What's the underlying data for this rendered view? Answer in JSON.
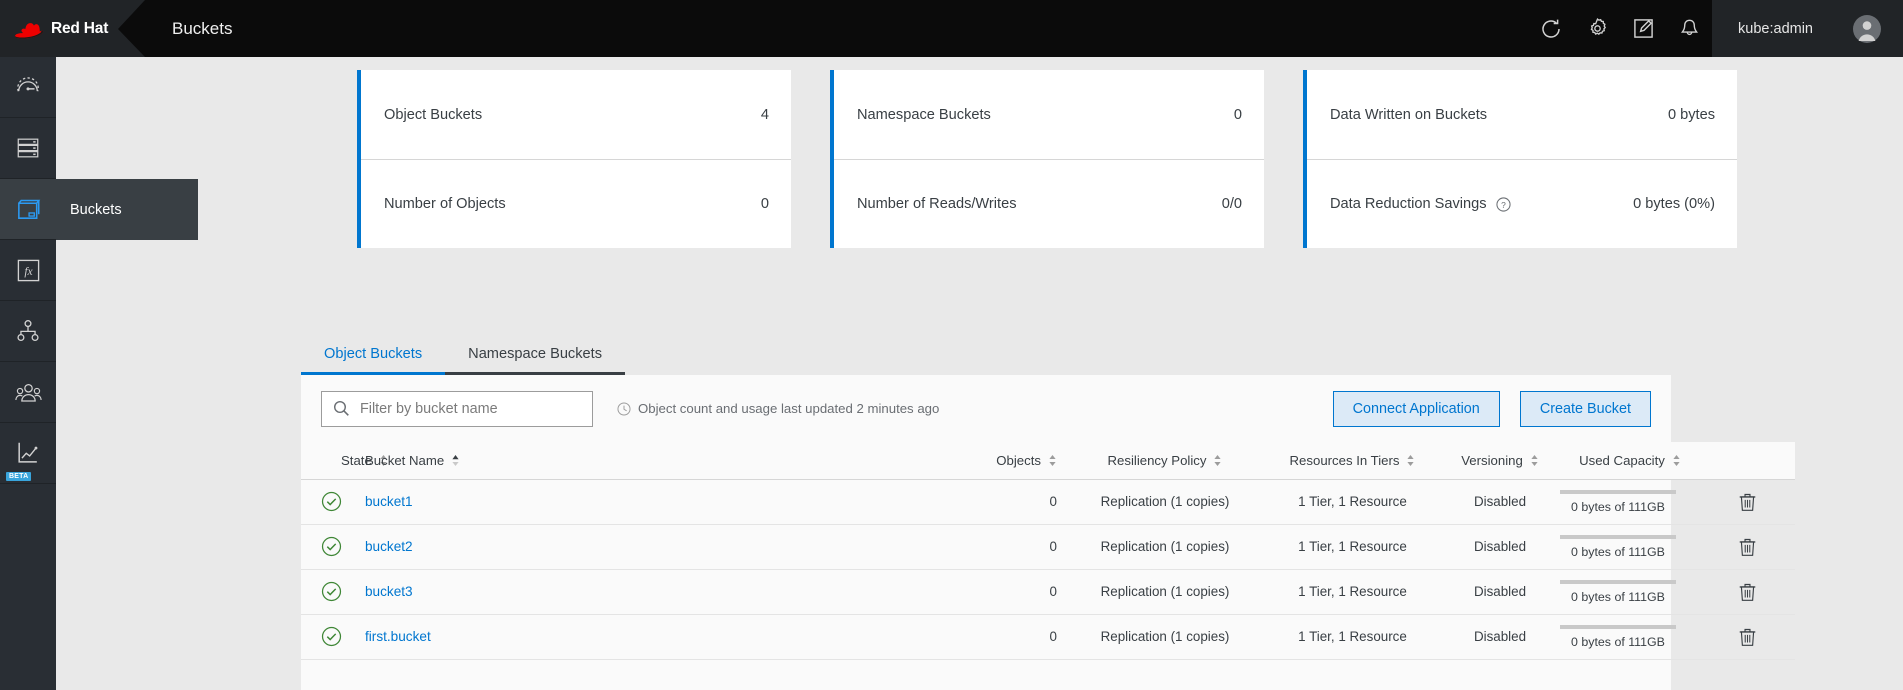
{
  "masthead": {
    "brand_name": "Red Hat",
    "page_title": "Buckets",
    "icons": [
      {
        "name": "refresh-icon",
        "label": "Refresh"
      },
      {
        "name": "gear-icon",
        "label": "Settings"
      },
      {
        "name": "import-yaml-icon",
        "label": "Import YAML"
      },
      {
        "name": "bell-icon",
        "label": "Notifications"
      }
    ],
    "user": "kube:admin",
    "avatar_icon": "avatar"
  },
  "sidebar": {
    "items": [
      {
        "label": "Overview",
        "icon": "gauge-icon",
        "active": false,
        "beta": false
      },
      {
        "label": "Storage",
        "icon": "server-stack-icon",
        "active": false,
        "beta": false
      },
      {
        "label": "Buckets",
        "icon": "bucket-icon",
        "active": true,
        "beta": false
      },
      {
        "label": "Functions",
        "icon": "function-fx-icon",
        "active": false,
        "beta": false
      },
      {
        "label": "Topology",
        "icon": "topology-icon",
        "active": false,
        "beta": false
      },
      {
        "label": "Accounts",
        "icon": "users-group-icon",
        "active": false,
        "beta": false
      },
      {
        "label": "Analytics",
        "icon": "chart-line-icon",
        "active": false,
        "beta": true
      }
    ],
    "flyout_label": "Buckets",
    "beta_badge": "BETA"
  },
  "cards": [
    {
      "name": "object-buckets-card",
      "accent": "#0076cf",
      "rows": [
        {
          "label": "Object Buckets",
          "value": "4",
          "help": false
        },
        {
          "label": "Number of Objects",
          "value": "0",
          "help": false
        }
      ]
    },
    {
      "name": "namespace-buckets-card",
      "accent": "#0076cf",
      "rows": [
        {
          "label": "Namespace Buckets",
          "value": "0",
          "help": false
        },
        {
          "label": "Number of Reads/Writes",
          "value": "0/0",
          "help": false
        }
      ]
    },
    {
      "name": "data-written-card",
      "accent": "#0076cf",
      "rows": [
        {
          "label": "Data Written on Buckets",
          "value": "0 bytes",
          "help": false
        },
        {
          "label": "Data Reduction Savings",
          "value": "0 bytes (0%)",
          "help": true
        }
      ]
    }
  ],
  "tabs": [
    {
      "label": "Object Buckets",
      "active": true
    },
    {
      "label": "Namespace Buckets",
      "active": false
    }
  ],
  "toolbar": {
    "search_placeholder": "Filter by bucket name",
    "search_value": "",
    "search_icon": "search-icon",
    "updated_icon": "clock-icon",
    "updated_note": "Object count and usage last updated 2 minutes ago",
    "connect_application_label": "Connect Application",
    "create_bucket_label": "Create Bucket"
  },
  "table": {
    "columns": [
      {
        "label": "State",
        "sortable": true,
        "sorted": "none"
      },
      {
        "label": "Bucket Name",
        "sortable": true,
        "sorted": "asc"
      },
      {
        "label": "Objects",
        "sortable": true,
        "sorted": "none"
      },
      {
        "label": "Resiliency Policy",
        "sortable": true,
        "sorted": "none"
      },
      {
        "label": "Resources In Tiers",
        "sortable": true,
        "sorted": "none"
      },
      {
        "label": "Versioning",
        "sortable": true,
        "sorted": "none"
      },
      {
        "label": "Used Capacity",
        "sortable": true,
        "sorted": "none"
      }
    ],
    "rows": [
      {
        "state": "healthy",
        "name": "bucket1",
        "objects": "0",
        "policy": "Replication (1 copies)",
        "tiers": "1 Tier, 1 Resource",
        "versioning": "Disabled",
        "capacity_text": "0 bytes of 111GB",
        "capacity_percent": 0,
        "delete_icon": "trash-icon"
      },
      {
        "state": "healthy",
        "name": "bucket2",
        "objects": "0",
        "policy": "Replication (1 copies)",
        "tiers": "1 Tier, 1 Resource",
        "versioning": "Disabled",
        "capacity_text": "0 bytes of 111GB",
        "capacity_percent": 0,
        "delete_icon": "trash-icon"
      },
      {
        "state": "healthy",
        "name": "bucket3",
        "objects": "0",
        "policy": "Replication (1 copies)",
        "tiers": "1 Tier, 1 Resource",
        "versioning": "Disabled",
        "capacity_text": "0 bytes of 111GB",
        "capacity_percent": 0,
        "delete_icon": "trash-icon"
      },
      {
        "state": "healthy",
        "name": "first.bucket",
        "objects": "0",
        "policy": "Replication (1 copies)",
        "tiers": "1 Tier, 1 Resource",
        "versioning": "Disabled",
        "capacity_text": "0 bytes of 111GB",
        "capacity_percent": 0,
        "delete_icon": "trash-icon"
      }
    ]
  },
  "colors": {
    "accent_blue": "#0076cf",
    "link_blue": "#0076cf",
    "healthy_green": "#3e8635",
    "masthead_bg": "#0b0b0b",
    "sidebar_bg": "#292e34",
    "page_bg": "#e9e9e9"
  }
}
